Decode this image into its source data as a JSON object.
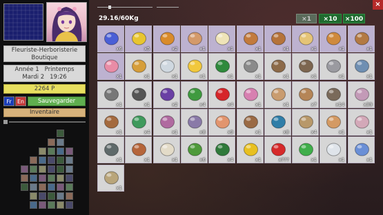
{
  "left_panel": {
    "shop_name": "Fleuriste-Herboristerie Boutique",
    "date": {
      "year": "Année 1",
      "season": "Printemps",
      "day": "Mardi",
      "day_num": "2",
      "time": "19:26"
    },
    "money": "2264 P",
    "lang_fr": "Fr",
    "lang_en": "En",
    "save_label": "Sauvegarder",
    "inventory_label": "Inventaire"
  },
  "inventory": {
    "weight": "29.16/60Kg",
    "qty_buttons": [
      "×1",
      "×10",
      "×100"
    ],
    "close_label": "×",
    "items": [
      {
        "name": "blue-flower",
        "count": "x6",
        "bg": "lav",
        "color": "#4a5fd6"
      },
      {
        "name": "yellow-flowers",
        "count": "x5",
        "bg": "lav",
        "color": "#e8c530"
      },
      {
        "name": "honey-jar",
        "count": "x2",
        "bg": "lav",
        "color": "#d98b2a"
      },
      {
        "name": "egg",
        "count": "x1",
        "bg": "lav",
        "color": "#d49a6a"
      },
      {
        "name": "milk-cup",
        "count": "x1",
        "bg": "lav",
        "color": "#efe4b8"
      },
      {
        "name": "bread-loaf",
        "count": "x1",
        "bg": "lav",
        "color": "#c27a3c"
      },
      {
        "name": "donut",
        "count": "x1",
        "bg": "lav",
        "color": "#b5733a"
      },
      {
        "name": "baguette",
        "count": "x1",
        "bg": "lav",
        "color": "#e5c477"
      },
      {
        "name": "eclair",
        "count": "x1",
        "bg": "lav",
        "color": "#cf8a3d"
      },
      {
        "name": "cookie",
        "count": "x1",
        "bg": "lav",
        "color": "#b37a43"
      },
      {
        "name": "soap-bar",
        "count": "x1",
        "bg": "lav",
        "color": "#e98ca6"
      },
      {
        "name": "cake-slice",
        "count": "x1",
        "bg": "gry",
        "color": "#d69e3a"
      },
      {
        "name": "blue-cheese",
        "count": "x1",
        "bg": "gry",
        "color": "#cfd8e0"
      },
      {
        "name": "cheese-block",
        "count": "x1",
        "bg": "gry",
        "color": "#f1c83d"
      },
      {
        "name": "green-bottle",
        "count": "x1",
        "bg": "gry",
        "color": "#2f8a3c"
      },
      {
        "name": "knife",
        "count": "x1",
        "bg": "gry",
        "color": "#8a8a8a"
      },
      {
        "name": "hammer",
        "count": "x1",
        "bg": "gry",
        "color": "#8c6a48"
      },
      {
        "name": "axe",
        "count": "x1",
        "bg": "gry",
        "color": "#7d6650"
      },
      {
        "name": "saw",
        "count": "x1",
        "bg": "gry",
        "color": "#9a9aa0"
      },
      {
        "name": "shovel",
        "count": "x1",
        "bg": "gry",
        "color": "#6f8fb2"
      },
      {
        "name": "pickaxe",
        "count": "x1",
        "bg": "gry",
        "color": "#777"
      },
      {
        "name": "metal-detector",
        "count": "x1",
        "bg": "gry",
        "color": "#555"
      },
      {
        "name": "violet-flowers",
        "count": "x2",
        "bg": "gry",
        "color": "#6a3fa4"
      },
      {
        "name": "clover-leaves",
        "count": "x4",
        "bg": "gry",
        "color": "#3f9a3f"
      },
      {
        "name": "ladybug",
        "count": "x4",
        "bg": "gry",
        "color": "#d6262a"
      },
      {
        "name": "pink-seashell",
        "count": "x1",
        "bg": "gry",
        "color": "#d77fb0"
      },
      {
        "name": "conch-shell",
        "count": "x1",
        "bg": "gry",
        "color": "#c99c6f"
      },
      {
        "name": "spiral-shell",
        "count": "x7",
        "bg": "gry",
        "color": "#b58557"
      },
      {
        "name": "fishing-rod",
        "count": "x14",
        "bg": "gry",
        "color": "#7a6a5a"
      },
      {
        "name": "cowrie-shell",
        "count": "x39",
        "bg": "gry",
        "color": "#c39ab7"
      },
      {
        "name": "rope-coil",
        "count": "x1",
        "bg": "gry",
        "color": "#a46a3e"
      },
      {
        "name": "green-shell",
        "count": "x4",
        "bg": "gry",
        "color": "#3f9a5c"
      },
      {
        "name": "cone-shell",
        "count": "x1",
        "bg": "gry",
        "color": "#b06aa0"
      },
      {
        "name": "sea-urchin",
        "count": "x8",
        "bg": "gry",
        "color": "#8a7aa8"
      },
      {
        "name": "scallop-shell",
        "count": "x9",
        "bg": "gry",
        "color": "#e2956e"
      },
      {
        "name": "wood-plank",
        "count": "x1",
        "bg": "gry",
        "color": "#9a6a44"
      },
      {
        "name": "blue-ammonite",
        "count": "x8",
        "bg": "gry",
        "color": "#2f7ea8"
      },
      {
        "name": "ammonite-shell",
        "count": "x4",
        "bg": "gry",
        "color": "#b8986a"
      },
      {
        "name": "whelk-shell",
        "count": "x1",
        "bg": "gry",
        "color": "#d49a63"
      },
      {
        "name": "nautilus-shell",
        "count": "x1",
        "bg": "gry",
        "color": "#d3a8b8"
      },
      {
        "name": "lizard",
        "count": "x1",
        "bg": "gry",
        "color": "#5f6a6a"
      },
      {
        "name": "brown-mushroom",
        "count": "x1",
        "bg": "gry",
        "color": "#b5653a"
      },
      {
        "name": "white-mushroom",
        "count": "x1",
        "bg": "gry",
        "color": "#e3dbc8"
      },
      {
        "name": "green-lizard",
        "count": "x6",
        "bg": "gry",
        "color": "#4e9a3a"
      },
      {
        "name": "green-beetle",
        "count": "x4",
        "bg": "gry",
        "color": "#2f7a3a"
      },
      {
        "name": "spotted-salamander",
        "count": "x1",
        "bg": "gry",
        "color": "#e8c020"
      },
      {
        "name": "red-poppy",
        "count": "x???",
        "bg": "gry",
        "color": "#d62a2a"
      },
      {
        "name": "gecko",
        "count": "x1",
        "bg": "gry",
        "color": "#3fae4a"
      },
      {
        "name": "coral",
        "count": "x1",
        "bg": "gry",
        "color": "#dfe4ea"
      },
      {
        "name": "magnifying-glass",
        "count": "x1",
        "bg": "gry",
        "color": "#6a8fd6"
      },
      {
        "name": "butterfly-net",
        "count": "x1",
        "bg": "gry",
        "color": "#b9a57a"
      }
    ]
  }
}
